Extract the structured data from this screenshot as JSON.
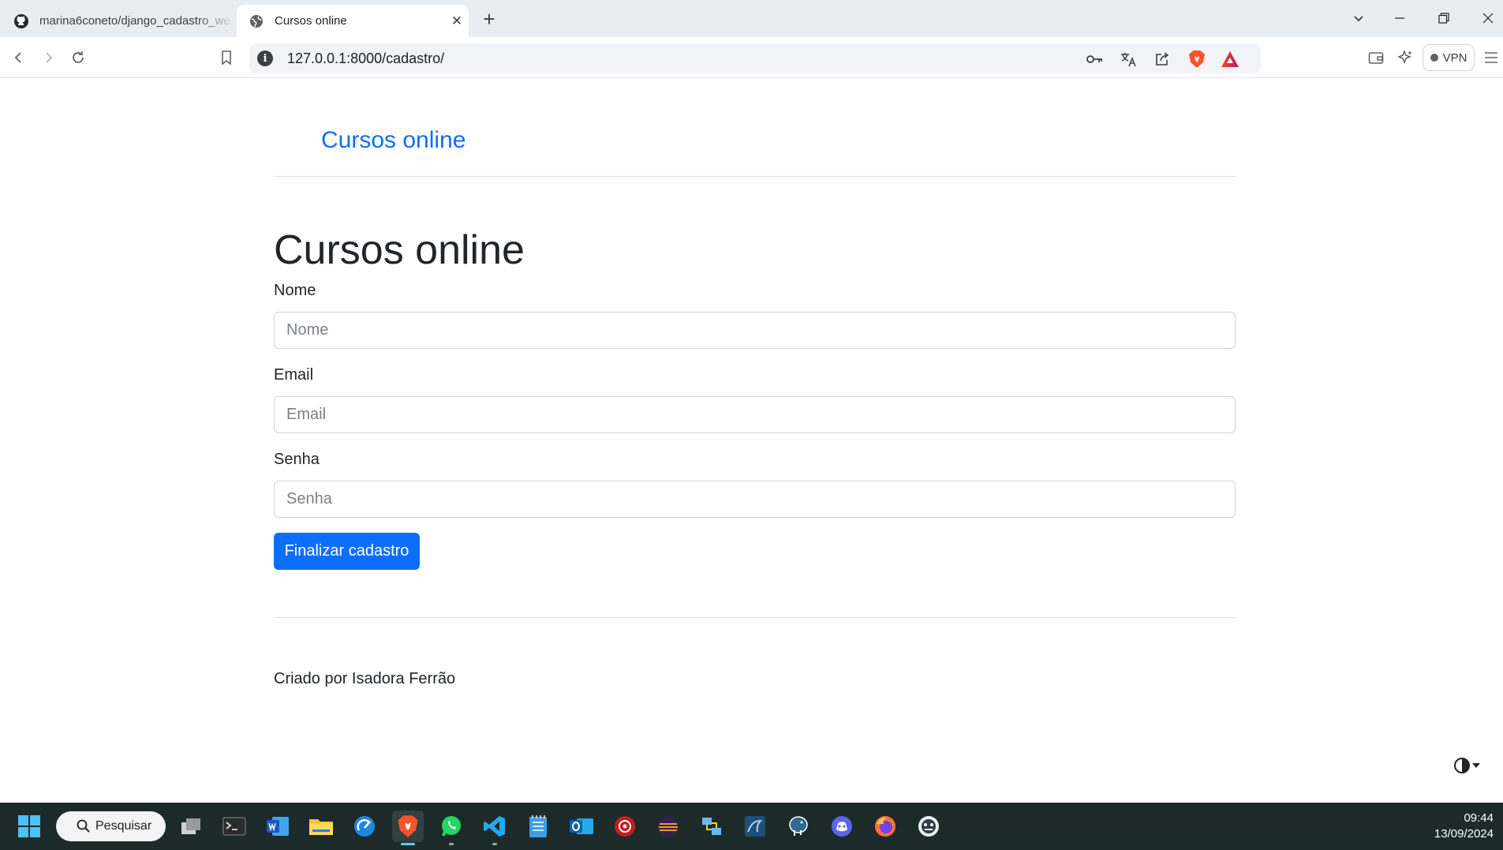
{
  "browser": {
    "tabs": [
      {
        "label": "marina6coneto/django_cadastro_we",
        "icon": "github-icon",
        "active": false
      },
      {
        "label": "Cursos online",
        "icon": "globe-icon",
        "active": true,
        "close": "✕"
      }
    ],
    "new_tab": "+",
    "address": "127.0.0.1:8000/cadastro/",
    "vpn_label": "VPN"
  },
  "page": {
    "brand": "Cursos online",
    "heading": "Cursos online",
    "form": {
      "nome_label": "Nome",
      "nome_placeholder": "Nome",
      "email_label": "Email",
      "email_placeholder": "Email",
      "senha_label": "Senha",
      "senha_placeholder": "Senha",
      "submit_label": "Finalizar cadastro"
    },
    "footer": "Criado por Isadora Ferrão"
  },
  "taskbar": {
    "search_label": "Pesquisar",
    "time": "09:44",
    "date": "13/09/2024"
  },
  "colors": {
    "primary": "#0d6efd",
    "taskbar_bg": "#1c2b2a",
    "tabstrip_bg": "#e9ecf1"
  }
}
